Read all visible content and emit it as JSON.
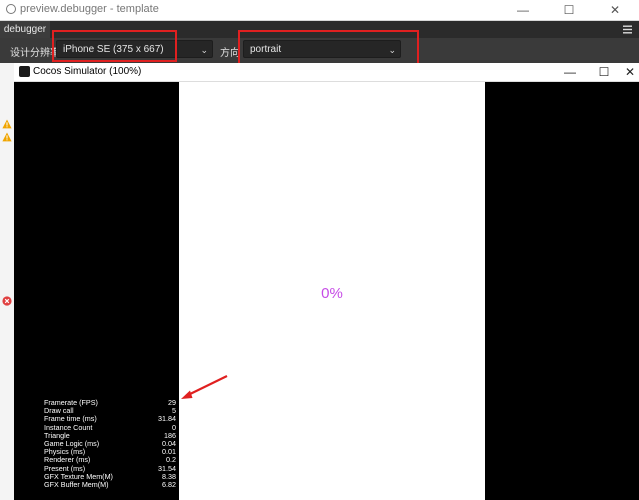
{
  "window": {
    "title": "preview.debugger - template",
    "minimize": "—",
    "maximize": "☐",
    "close": "✕"
  },
  "tabs": [
    {
      "label": "debugger"
    }
  ],
  "toolbar": {
    "design_resolution_label": "设计分辨率",
    "device_value": "iPhone SE (375 x 667)",
    "orientation_label": "方向",
    "orientation_value": "portrait",
    "chevron": "⌄"
  },
  "simulator": {
    "title": "Cocos Simulator (100%)",
    "minimize": "—",
    "maximize": "☐",
    "close": "✕",
    "loading_percent": "0%"
  },
  "stats": [
    {
      "label": "Framerate (FPS)",
      "value": "29"
    },
    {
      "label": "Draw call",
      "value": "5"
    },
    {
      "label": "Frame time (ms)",
      "value": "31.84"
    },
    {
      "label": "Instance Count",
      "value": "0"
    },
    {
      "label": "Triangle",
      "value": "186"
    },
    {
      "label": "Game Logic (ms)",
      "value": "0.04"
    },
    {
      "label": "Physics (ms)",
      "value": "0.01"
    },
    {
      "label": "Renderer (ms)",
      "value": "0.2"
    },
    {
      "label": "Present (ms)",
      "value": "31.54"
    },
    {
      "label": "GFX Texture Mem(M)",
      "value": "8.38"
    },
    {
      "label": "GFX Buffer Mem(M)",
      "value": "6.82"
    }
  ],
  "colors": {
    "highlight_box": "#e02020",
    "arrow": "#e02020",
    "loading_text": "#c64be6",
    "warning": "#f0a500",
    "error": "#e04040"
  },
  "icons": [
    "menu-icon",
    "warning-icon",
    "error-icon",
    "chevron-down-icon",
    "red-arrow-annotation"
  ]
}
